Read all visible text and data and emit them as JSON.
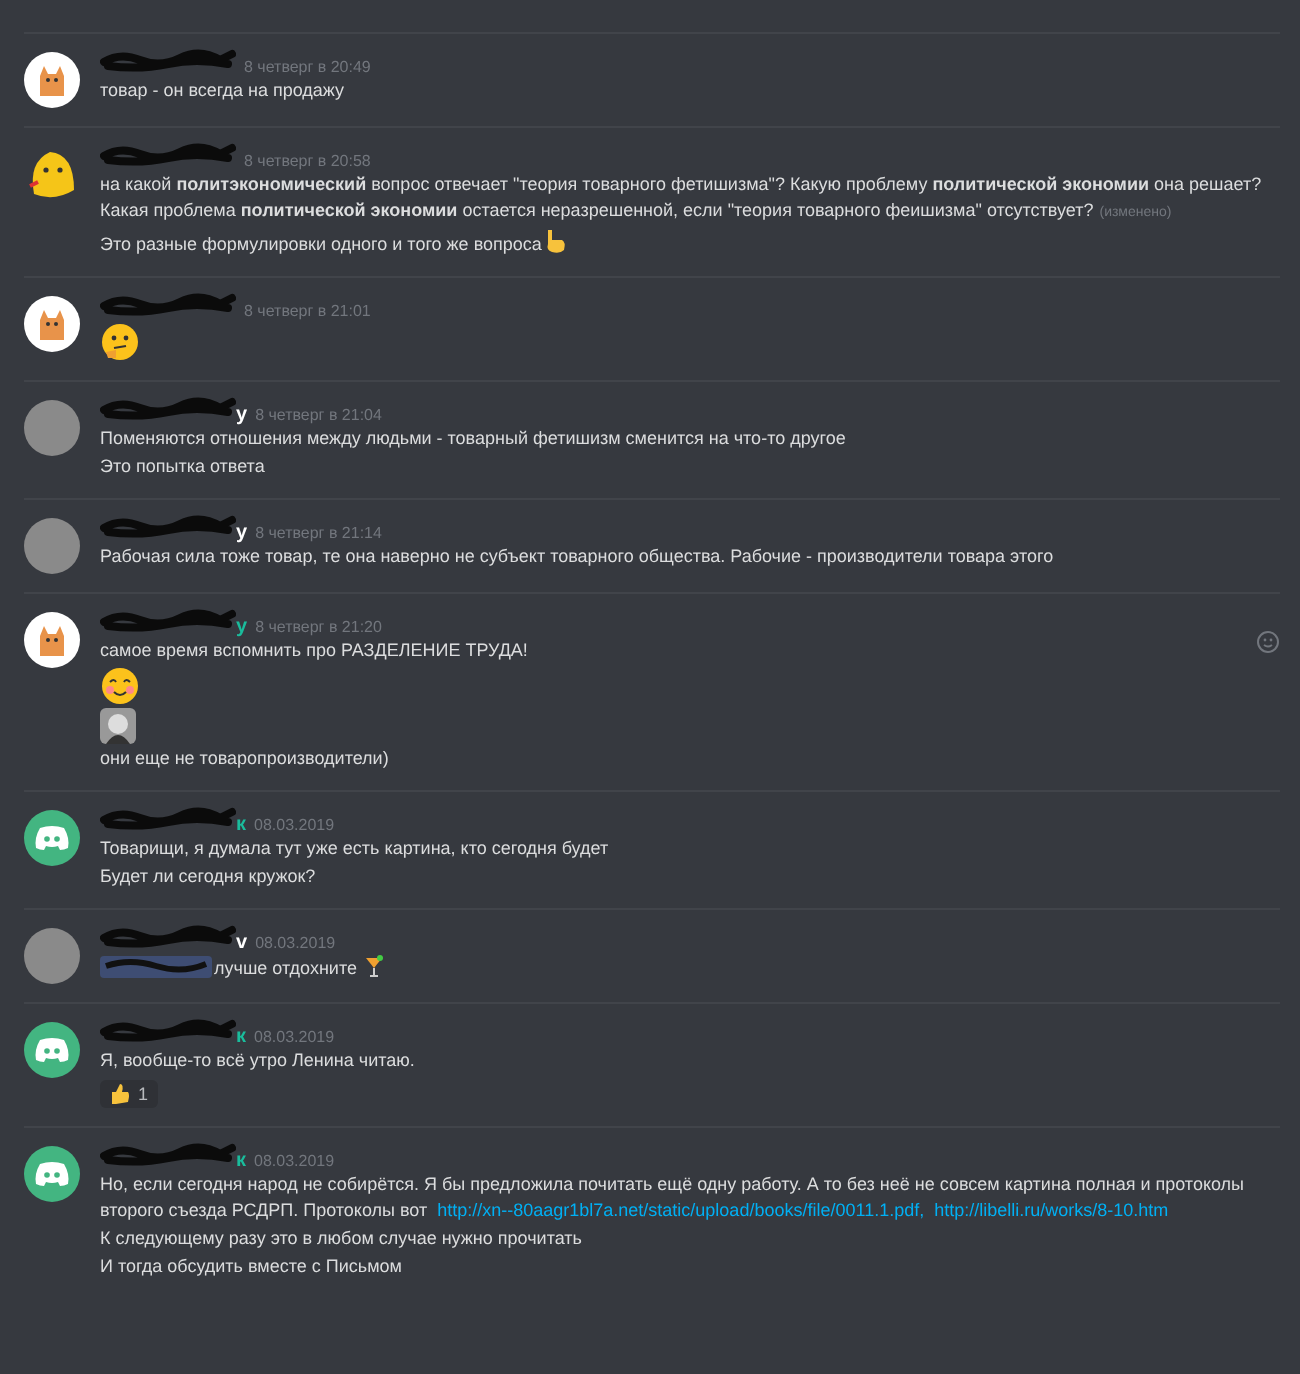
{
  "messages": [
    {
      "avatar": {
        "kind": "cat"
      },
      "time": "8 четверг в 20:49",
      "lines": [
        {
          "kind": "text",
          "text": "товар - он всегда на продажу"
        }
      ]
    },
    {
      "avatar": {
        "kind": "blob"
      },
      "time": "8 четверг в 20:58",
      "lines": [
        {
          "kind": "text",
          "text": "на какой **политэкономический** вопрос отвечает \"теория товарного фетишизма\"? Какую проблему **политической экономии** она решает? Какая проблема **политической экономии** остается неразрешенной, если \"теория товарного феишизма\" отсутствует?",
          "edited": "(изменено)"
        },
        {
          "kind": "text",
          "text": "Это разные формулировки одного и того же вопроса",
          "trailing": {
            "kind": "hand"
          }
        }
      ]
    },
    {
      "avatar": {
        "kind": "cat"
      },
      "time": "8 четверг в 21:01",
      "lines": [
        {
          "kind": "thinking"
        }
      ]
    },
    {
      "avatar": {
        "kind": "photo"
      },
      "author": {
        "tail": "y",
        "color": "#ffffff"
      },
      "time": "8 четверг в 21:04",
      "lines": [
        {
          "kind": "text",
          "text": "Поменяются отношения между людьми - товарный фетишизм сменится на что-то другое"
        },
        {
          "kind": "text",
          "text": "Это попытка ответа"
        }
      ]
    },
    {
      "avatar": {
        "kind": "photo"
      },
      "author": {
        "tail": "y",
        "color": "#ffffff"
      },
      "time": "8 четверг в 21:14",
      "lines": [
        {
          "kind": "text",
          "text": "Рабочая сила тоже товар, те она наверно не субъект товарного общества. Рабочие - производители товара этого"
        }
      ]
    },
    {
      "avatar": {
        "kind": "cat"
      },
      "author": {
        "tail": "y",
        "color": "#1abc9c"
      },
      "time": "8 четверг в 21:20",
      "add_reaction": true,
      "lines": [
        {
          "kind": "text",
          "text": "самое время вспомнить про РАЗДЕЛЕНИЕ ТРУДА!"
        },
        {
          "kind": "blush"
        },
        {
          "kind": "portrait"
        },
        {
          "kind": "text",
          "text": "они еще не товаропроизводители)"
        }
      ]
    },
    {
      "avatar": {
        "kind": "discord"
      },
      "author": {
        "tail": "к",
        "color": "#1abc9c"
      },
      "time": "08.03.2019",
      "lines": [
        {
          "kind": "text",
          "text": "Товарищи,  я думала тут уже есть картина, кто сегодня будет"
        },
        {
          "kind": "text",
          "text": "Будет ли сегодня кружок?"
        }
      ]
    },
    {
      "avatar": {
        "kind": "photo"
      },
      "author": {
        "tail": "v",
        "color": "#ffffff"
      },
      "time": "08.03.2019",
      "lines": [
        {
          "kind": "text",
          "mention": true,
          "text": "лучше отдохните",
          "trailing": {
            "kind": "drink"
          }
        }
      ]
    },
    {
      "avatar": {
        "kind": "discord"
      },
      "author": {
        "tail": "к",
        "color": "#1abc9c"
      },
      "time": "08.03.2019",
      "lines": [
        {
          "kind": "text",
          "text": "Я, вообще-то всё утро Ленина читаю."
        }
      ],
      "reaction": {
        "count": "1"
      }
    },
    {
      "avatar": {
        "kind": "discord"
      },
      "author": {
        "tail": "к",
        "color": "#1abc9c"
      },
      "time": "08.03.2019",
      "lines": [
        {
          "kind": "text",
          "text": "Но, если сегодня народ не собирётся. Я бы предложила почитать ещё одну работу. А то без неё не совсем картина полная и протоколы второго съезда РСДРП. Протоколы вот",
          "links": [
            "http://xn--80aagr1bl7a.net/static/upload/books/file/0011.1.pdf,",
            "http://libelli.ru/works/8-10.htm"
          ]
        },
        {
          "kind": "text",
          "text": "К следующему разу это в любом случае нужно прочитать"
        },
        {
          "kind": "text",
          "text": "И тогда обсудить вместе с Письмом"
        }
      ]
    }
  ]
}
